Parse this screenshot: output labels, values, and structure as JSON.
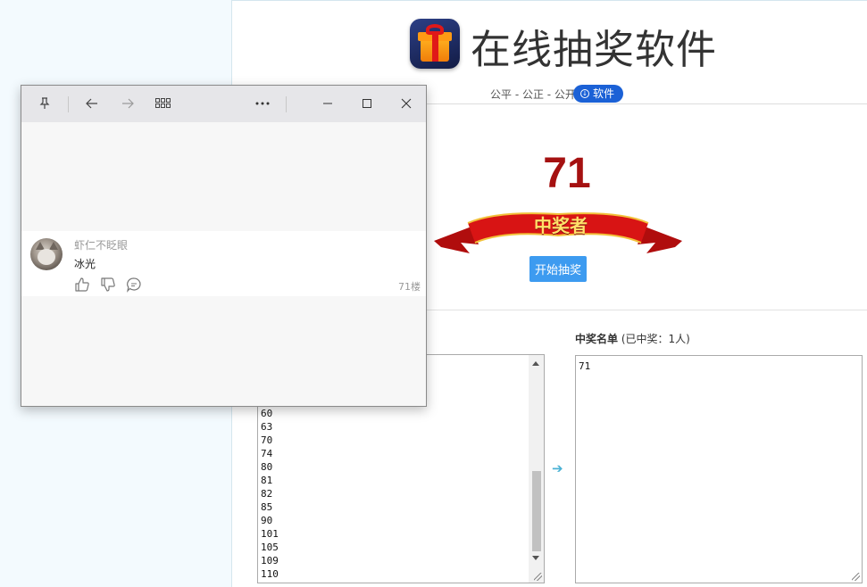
{
  "lottery": {
    "title": "在线抽奖软件",
    "tagline": "公平 - 公正 - 公开",
    "download_label": "软件",
    "current_number": "71",
    "banner_label": "中奖者",
    "start_label": "开始抽奖",
    "pool": [
      "60",
      "63",
      "70",
      "74",
      "80",
      "81",
      "82",
      "85",
      "90",
      "101",
      "105",
      "109",
      "110"
    ],
    "winners_heading": "中奖名单",
    "winners_count": "(已中奖：1人)",
    "winners": [
      "71"
    ]
  },
  "popup": {
    "comment": {
      "username": "虾仁不眨眼",
      "text": "冰光",
      "floor": "71楼"
    }
  },
  "colors": {
    "number": "#a51111",
    "start_button": "#3d9bf0",
    "download_button": "#1b61d6",
    "banner_red": "#d81414",
    "banner_text": "#ffe16a"
  }
}
